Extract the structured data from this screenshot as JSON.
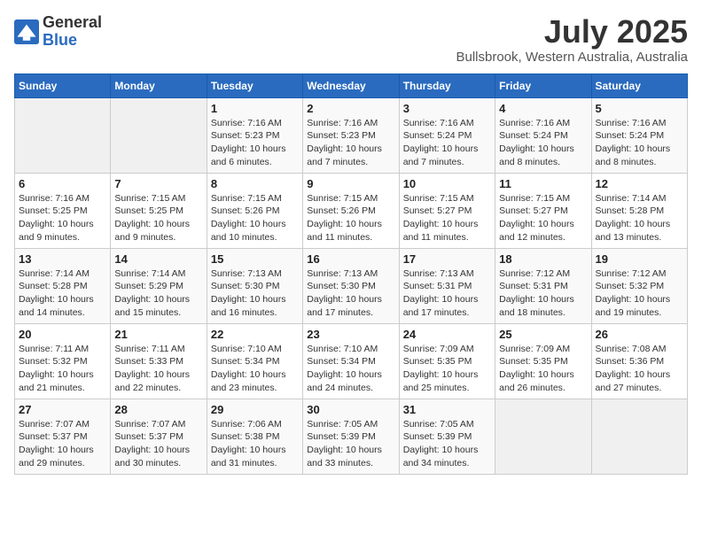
{
  "logo": {
    "general": "General",
    "blue": "Blue"
  },
  "title": {
    "month": "July 2025",
    "location": "Bullsbrook, Western Australia, Australia"
  },
  "headers": [
    "Sunday",
    "Monday",
    "Tuesday",
    "Wednesday",
    "Thursday",
    "Friday",
    "Saturday"
  ],
  "weeks": [
    [
      {
        "day": "",
        "info": ""
      },
      {
        "day": "",
        "info": ""
      },
      {
        "day": "1",
        "info": "Sunrise: 7:16 AM\nSunset: 5:23 PM\nDaylight: 10 hours and 6 minutes."
      },
      {
        "day": "2",
        "info": "Sunrise: 7:16 AM\nSunset: 5:23 PM\nDaylight: 10 hours and 7 minutes."
      },
      {
        "day": "3",
        "info": "Sunrise: 7:16 AM\nSunset: 5:24 PM\nDaylight: 10 hours and 7 minutes."
      },
      {
        "day": "4",
        "info": "Sunrise: 7:16 AM\nSunset: 5:24 PM\nDaylight: 10 hours and 8 minutes."
      },
      {
        "day": "5",
        "info": "Sunrise: 7:16 AM\nSunset: 5:24 PM\nDaylight: 10 hours and 8 minutes."
      }
    ],
    [
      {
        "day": "6",
        "info": "Sunrise: 7:16 AM\nSunset: 5:25 PM\nDaylight: 10 hours and 9 minutes."
      },
      {
        "day": "7",
        "info": "Sunrise: 7:15 AM\nSunset: 5:25 PM\nDaylight: 10 hours and 9 minutes."
      },
      {
        "day": "8",
        "info": "Sunrise: 7:15 AM\nSunset: 5:26 PM\nDaylight: 10 hours and 10 minutes."
      },
      {
        "day": "9",
        "info": "Sunrise: 7:15 AM\nSunset: 5:26 PM\nDaylight: 10 hours and 11 minutes."
      },
      {
        "day": "10",
        "info": "Sunrise: 7:15 AM\nSunset: 5:27 PM\nDaylight: 10 hours and 11 minutes."
      },
      {
        "day": "11",
        "info": "Sunrise: 7:15 AM\nSunset: 5:27 PM\nDaylight: 10 hours and 12 minutes."
      },
      {
        "day": "12",
        "info": "Sunrise: 7:14 AM\nSunset: 5:28 PM\nDaylight: 10 hours and 13 minutes."
      }
    ],
    [
      {
        "day": "13",
        "info": "Sunrise: 7:14 AM\nSunset: 5:28 PM\nDaylight: 10 hours and 14 minutes."
      },
      {
        "day": "14",
        "info": "Sunrise: 7:14 AM\nSunset: 5:29 PM\nDaylight: 10 hours and 15 minutes."
      },
      {
        "day": "15",
        "info": "Sunrise: 7:13 AM\nSunset: 5:30 PM\nDaylight: 10 hours and 16 minutes."
      },
      {
        "day": "16",
        "info": "Sunrise: 7:13 AM\nSunset: 5:30 PM\nDaylight: 10 hours and 17 minutes."
      },
      {
        "day": "17",
        "info": "Sunrise: 7:13 AM\nSunset: 5:31 PM\nDaylight: 10 hours and 17 minutes."
      },
      {
        "day": "18",
        "info": "Sunrise: 7:12 AM\nSunset: 5:31 PM\nDaylight: 10 hours and 18 minutes."
      },
      {
        "day": "19",
        "info": "Sunrise: 7:12 AM\nSunset: 5:32 PM\nDaylight: 10 hours and 19 minutes."
      }
    ],
    [
      {
        "day": "20",
        "info": "Sunrise: 7:11 AM\nSunset: 5:32 PM\nDaylight: 10 hours and 21 minutes."
      },
      {
        "day": "21",
        "info": "Sunrise: 7:11 AM\nSunset: 5:33 PM\nDaylight: 10 hours and 22 minutes."
      },
      {
        "day": "22",
        "info": "Sunrise: 7:10 AM\nSunset: 5:34 PM\nDaylight: 10 hours and 23 minutes."
      },
      {
        "day": "23",
        "info": "Sunrise: 7:10 AM\nSunset: 5:34 PM\nDaylight: 10 hours and 24 minutes."
      },
      {
        "day": "24",
        "info": "Sunrise: 7:09 AM\nSunset: 5:35 PM\nDaylight: 10 hours and 25 minutes."
      },
      {
        "day": "25",
        "info": "Sunrise: 7:09 AM\nSunset: 5:35 PM\nDaylight: 10 hours and 26 minutes."
      },
      {
        "day": "26",
        "info": "Sunrise: 7:08 AM\nSunset: 5:36 PM\nDaylight: 10 hours and 27 minutes."
      }
    ],
    [
      {
        "day": "27",
        "info": "Sunrise: 7:07 AM\nSunset: 5:37 PM\nDaylight: 10 hours and 29 minutes."
      },
      {
        "day": "28",
        "info": "Sunrise: 7:07 AM\nSunset: 5:37 PM\nDaylight: 10 hours and 30 minutes."
      },
      {
        "day": "29",
        "info": "Sunrise: 7:06 AM\nSunset: 5:38 PM\nDaylight: 10 hours and 31 minutes."
      },
      {
        "day": "30",
        "info": "Sunrise: 7:05 AM\nSunset: 5:39 PM\nDaylight: 10 hours and 33 minutes."
      },
      {
        "day": "31",
        "info": "Sunrise: 7:05 AM\nSunset: 5:39 PM\nDaylight: 10 hours and 34 minutes."
      },
      {
        "day": "",
        "info": ""
      },
      {
        "day": "",
        "info": ""
      }
    ]
  ]
}
